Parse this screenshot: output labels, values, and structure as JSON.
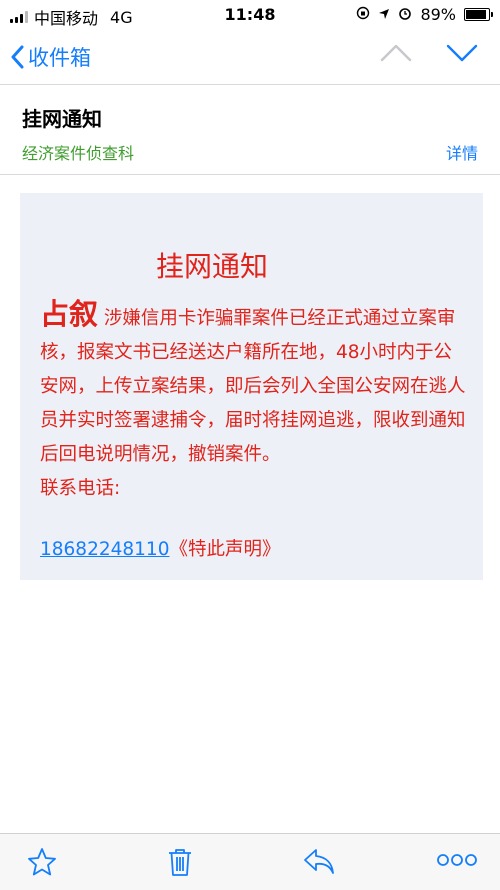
{
  "status_bar": {
    "carrier": "中国移动",
    "network": "4G",
    "time": "11:48",
    "battery": "89%",
    "battery_level": 0.89
  },
  "nav": {
    "back_label": "收件箱"
  },
  "header": {
    "subject": "挂网通知",
    "sender": "经济案件侦查科",
    "details": "详情"
  },
  "message": {
    "title": "挂网通知",
    "name": "占叙",
    "body": "涉嫌信用卡诈骗罪案件已经正式通过立案审核，报案文书已经送达户籍所在地，48小时内于公安网，上传立案结果，即后会列入全国公安网在逃人员并实时签署逮捕令，届时将挂网追逃，限收到通知后回电说明情况，撤销案件。",
    "contact_label": "联系电话:",
    "phone": "18682248110",
    "phone_suffix": "《特此声明》"
  },
  "colors": {
    "accent": "#157efb",
    "alert_red": "#e0241b",
    "sender_green": "#3f9d2e",
    "card_bg": "#eef0f7"
  },
  "toolbar": {
    "icons": [
      "star-icon",
      "trash-icon",
      "reply-icon",
      "more-icon"
    ]
  }
}
